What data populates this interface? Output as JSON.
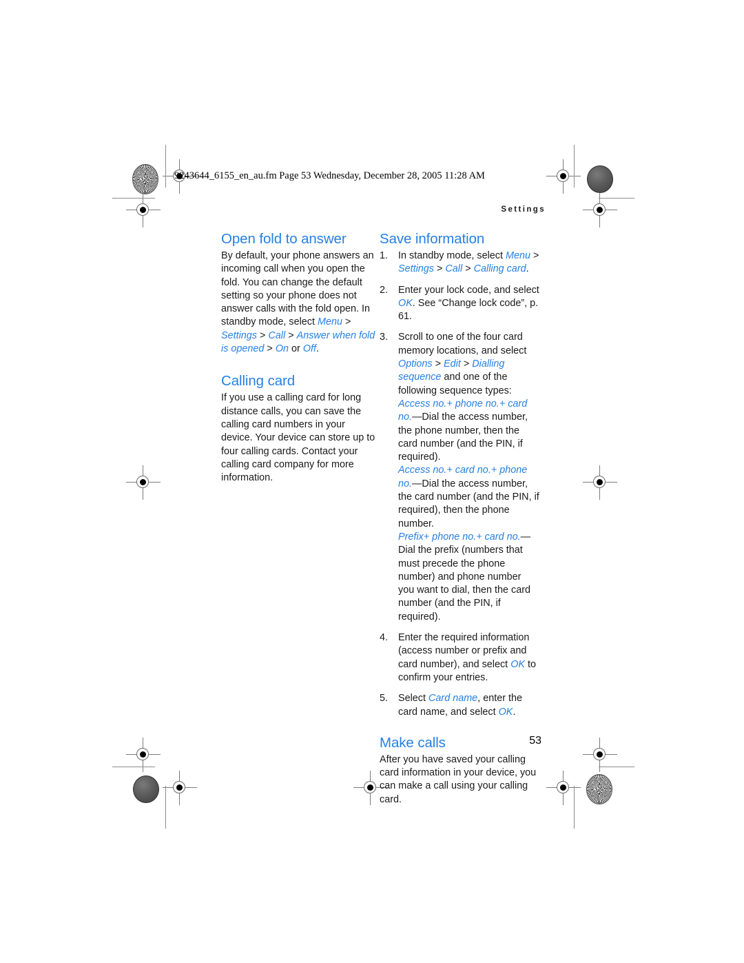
{
  "page": {
    "file_stamp": "9243644_6155_en_au.fm  Page 53  Wednesday, December 28, 2005  11:28 AM",
    "running_head": "Settings",
    "folio": "53",
    "accent_color": "#2680e3",
    "text_color": "#1a1a1a",
    "background": "#ffffff"
  },
  "left_column": {
    "section1": {
      "heading": "Open fold to answer",
      "paragraph_lead": "By default, your phone answers an incoming call when you open the fold. You can change the default setting so your phone does not answer calls with the fold open. In standby mode, select ",
      "path": {
        "t1": "Menu",
        "s1": " > ",
        "t2": "Settings",
        "s2": " > ",
        "t3": "Call",
        "s3": " > ",
        "t4": "Answer when fold is opened",
        "s4": " > ",
        "t5": "On",
        "s5": " or ",
        "t6": "Off",
        "end": "."
      }
    },
    "section2": {
      "heading": "Calling card",
      "paragraph": "If you use a calling card for long distance calls, you can save the calling card numbers in your device. Your device can store up to four calling cards. Contact your calling card company for more information."
    }
  },
  "right_column": {
    "section1": {
      "heading": "Save information",
      "steps": [
        {
          "num": "1.",
          "pre": "In standby mode, select ",
          "path": [
            {
              "kind": "term",
              "text": "Menu"
            },
            {
              "kind": "sep",
              "text": " > "
            },
            {
              "kind": "term",
              "text": "Settings"
            },
            {
              "kind": "sep",
              "text": " > "
            },
            {
              "kind": "term",
              "text": "Call"
            },
            {
              "kind": "sep",
              "text": " > "
            },
            {
              "kind": "term",
              "text": "Calling card"
            },
            {
              "kind": "sep",
              "text": "."
            }
          ],
          "post": ""
        },
        {
          "num": "2.",
          "pre": "Enter your lock code, and select ",
          "path": [
            {
              "kind": "term",
              "text": "OK"
            },
            {
              "kind": "sep",
              "text": ". "
            }
          ],
          "post": "See “Change lock code”, p. 61."
        },
        {
          "num": "3.",
          "pre": "Scroll to one of the four card memory locations, and select ",
          "path": [
            {
              "kind": "term",
              "text": "Options"
            },
            {
              "kind": "sep",
              "text": " > "
            },
            {
              "kind": "term",
              "text": "Edit"
            },
            {
              "kind": "sep",
              "text": " > "
            },
            {
              "kind": "term",
              "text": "Dialling sequence"
            },
            {
              "kind": "sep",
              "text": " "
            }
          ],
          "post": "and one of the following sequence types:",
          "subparas": [
            {
              "term": "Access no.+ phone no.+ card no.",
              "dash": "—",
              "text": "Dial the access number, the phone number, then the card number (and the PIN, if required)."
            },
            {
              "term": "Access no.+ card no.+ phone no.",
              "dash": "—",
              "text": "Dial the access number, the card number (and the PIN, if required), then the phone number."
            },
            {
              "term": "Prefix+ phone no.+ card no.",
              "dash": "—",
              "text": "Dial the prefix (numbers that must precede the phone number) and phone number you want to dial, then the card number (and the PIN, if required)."
            }
          ]
        },
        {
          "num": "4.",
          "pre": "Enter the required information (access number or prefix and card number), and select ",
          "path": [
            {
              "kind": "term",
              "text": "OK"
            },
            {
              "kind": "sep",
              "text": " "
            }
          ],
          "post": "to confirm your entries."
        },
        {
          "num": "5.",
          "pre": "Select ",
          "path": [
            {
              "kind": "term",
              "text": "Card name"
            },
            {
              "kind": "sep",
              "text": ", "
            }
          ],
          "post": "enter the card name, and select ",
          "tail_term": "OK",
          "tail_end": "."
        }
      ]
    },
    "section2": {
      "heading": "Make calls",
      "paragraph": "After you have saved your calling card information in your device, you can make a call using your calling card."
    }
  }
}
